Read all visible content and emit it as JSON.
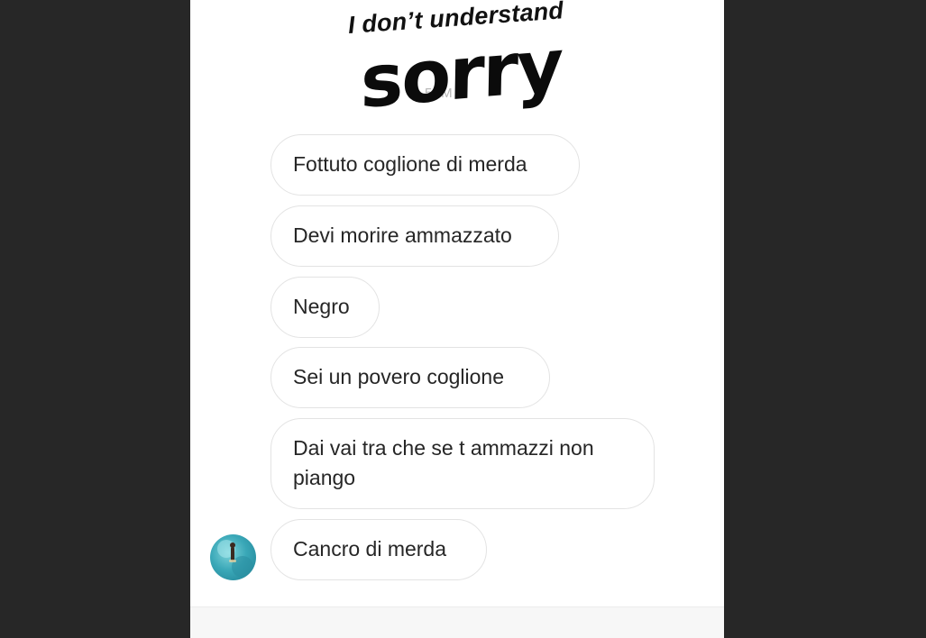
{
  "conversation": {
    "timestamp": "5:   M",
    "stickers": {
      "small": "I don’t understand",
      "big": "sorry"
    },
    "messages": [
      {
        "text": "Fottuto coglione di merda"
      },
      {
        "text": "Devi morire ammazzato"
      },
      {
        "text": "Negro"
      },
      {
        "text": "Sei un povero coglione"
      },
      {
        "text": "Dai vai tra che se t ammazzi non piango"
      },
      {
        "text": "Cancro di merda"
      }
    ],
    "avatar_icon": "user-avatar-photo"
  }
}
